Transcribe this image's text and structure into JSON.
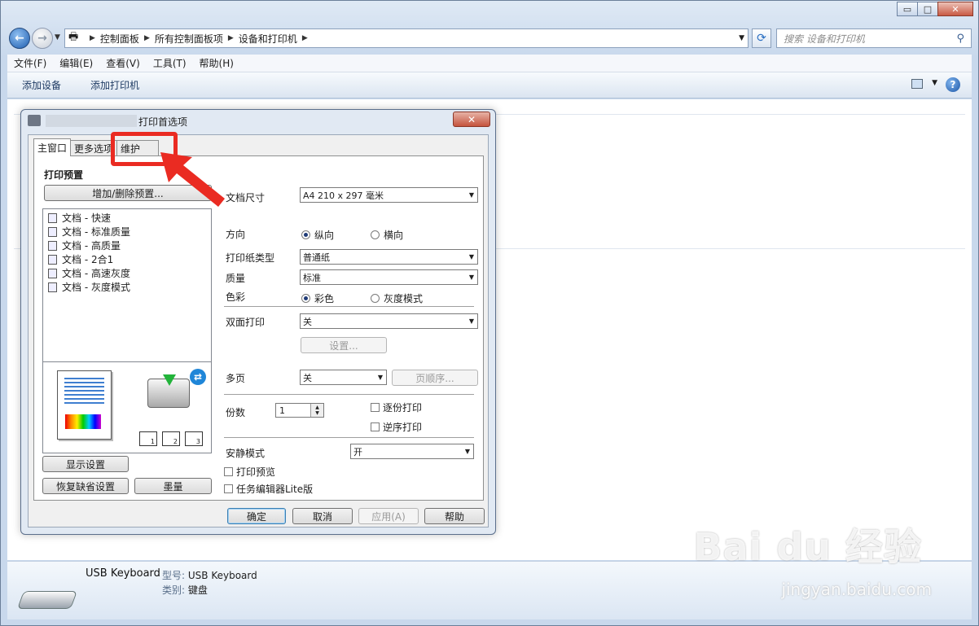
{
  "explorer": {
    "breadcrumbs": [
      "控制面板",
      "所有控制面板项",
      "设备和打印机"
    ],
    "search_placeholder": "搜索 设备和打印机",
    "menu": [
      "文件(F)",
      "编辑(E)",
      "查看(V)",
      "工具(T)",
      "帮助(H)"
    ],
    "commands": [
      "添加设备",
      "添加打印机"
    ],
    "device": {
      "name": "USB Keyboard",
      "model_label": "型号:",
      "model": "USB Keyboard",
      "category_label": "类别:",
      "category": "键盘"
    },
    "caption_buttons": {
      "minimize": "▭",
      "maximize": "□",
      "close": "✕"
    }
  },
  "dialog": {
    "title": "打印首选项",
    "tabs": [
      "主窗口",
      "更多选项",
      "维护"
    ],
    "presets_title": "打印预置",
    "add_remove_preset": "增加/删除预置...",
    "presets": [
      {
        "label": "文档 - 快速",
        "icon": "doc-fast-icon"
      },
      {
        "label": "文档 - 标准质量",
        "icon": "doc-standard-icon"
      },
      {
        "label": "文档 - 高质量",
        "icon": "doc-high-icon"
      },
      {
        "label": "文档 - 2合1",
        "icon": "doc-2in1-icon"
      },
      {
        "label": "文档 - 高速灰度",
        "icon": "doc-gray-fast-icon"
      },
      {
        "label": "文档 - 灰度模式",
        "icon": "doc-gray-icon"
      }
    ],
    "show_settings": "显示设置",
    "restore_defaults": "恢复缺省设置",
    "ink_levels": "墨量",
    "paper_size_label": "文档尺寸",
    "paper_size_value": "A4 210 x 297 毫米",
    "orientation_label": "方向",
    "orientation_options": [
      "纵向",
      "横向"
    ],
    "orientation_selected": "纵向",
    "paper_type_label": "打印纸类型",
    "paper_type_value": "普通纸",
    "quality_label": "质量",
    "quality_value": "标准",
    "color_label": "色彩",
    "color_options": [
      "彩色",
      "灰度模式"
    ],
    "color_selected": "彩色",
    "duplex_label": "双面打印",
    "duplex_value": "关",
    "duplex_settings": "设置...",
    "multipage_label": "多页",
    "multipage_value": "关",
    "page_order": "页顺序...",
    "copies_label": "份数",
    "copies_value": "1",
    "collate": "逐份打印",
    "reverse": "逆序打印",
    "quiet_label": "安静模式",
    "quiet_value": "开",
    "print_preview": "打印预览",
    "job_arranger": "任务编辑器Lite版",
    "buttons": {
      "ok": "确定",
      "cancel": "取消",
      "apply": "应用(A)",
      "help": "帮助"
    },
    "close_glyph": "✕",
    "copy_stack_numbers": [
      "1",
      "2",
      "3"
    ]
  },
  "watermark": {
    "brand": "Bai du 经验",
    "url": "jingyan.baidu.com"
  },
  "colors": {
    "annotation": "#ea2b22",
    "accent": "#1f86d8"
  }
}
